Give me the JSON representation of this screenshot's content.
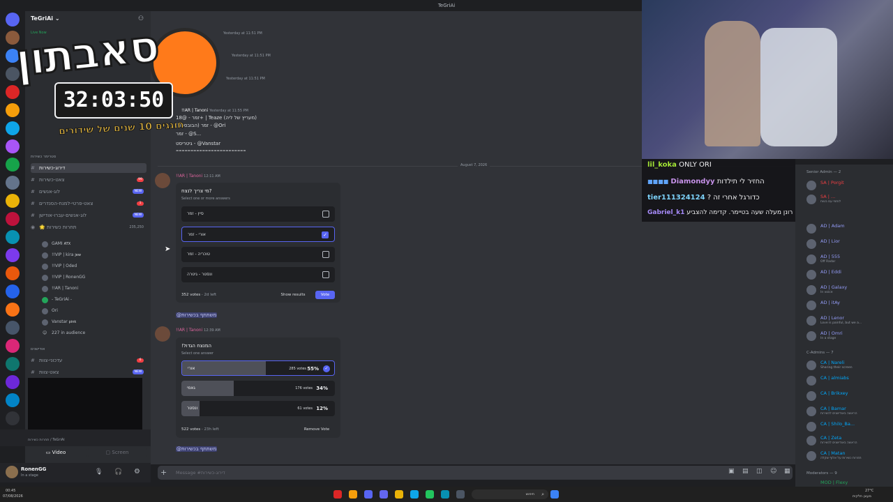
{
  "window": {
    "title": "TeGriAi"
  },
  "server": {
    "name": "TeGriAi",
    "live_label": "Live Now"
  },
  "overlay": {
    "title": "סאבתון",
    "timer": "32:03:50",
    "subtitle": "חוגגים 10 שנים של שידורים"
  },
  "sidebar": {
    "category_1": "סטרימר כשירות",
    "channels": [
      {
        "name": "דירוג-כשירות",
        "active": true
      },
      {
        "name": "צאט-כשירות",
        "badge": "99"
      },
      {
        "name": "לוג-אנשים",
        "badge": "NEW"
      },
      {
        "name": "צאט-פרטי-למנח-הסנדרים",
        "badge": "1"
      },
      {
        "name": "לוג-אנשים-עברו-אודישן",
        "badge": "NEW"
      },
      {
        "name": "🌟 תחרות כשירות",
        "badge": "235,250"
      }
    ],
    "voice_members": [
      {
        "name": "GAMI",
        "tag": "ATX"
      },
      {
        "name": "!!VIP | kira",
        "tag": "jew"
      },
      {
        "name": "!!VIP | Oded"
      },
      {
        "name": "!!VIP | RonenGG"
      },
      {
        "name": "!!AR | Tanoni"
      },
      {
        "name": "- TeGriAi -"
      },
      {
        "name": "Ori"
      },
      {
        "name": "Vanstar",
        "tag": "pink"
      }
    ],
    "audience": "227 in audience",
    "category_2": "אודישנים",
    "channels_2": [
      {
        "name": "עדכוני-צוות",
        "badge": "6"
      },
      {
        "name": "צאט-צוות",
        "badge": "NEW"
      }
    ],
    "voice_status": "תחרות כשירות / TeGriAi",
    "video_label": "Video",
    "screen_label": "Screen",
    "user": {
      "name": "RonenGG",
      "status": "In a stage"
    }
  },
  "chat": {
    "top_messages": [
      {
        "time": "Yesterday at 11:51 PM"
      },
      {
        "time": "Yesterday at 11:51 PM"
      },
      {
        "time": "Yesterday at 11:51 PM"
      }
    ],
    "prev_msg": {
      "author": "!!AR | Tanoni",
      "time": "Yesterday at 11:55 PM",
      "lines": [
        "זמר - @18+ | Teaze (מעריץ של ליה)",
        "זמר (הבובספוג) - @Ori",
        "זמר - @S...",
        "גיטריסט - @Vanstar"
      ],
      "divider": "========================"
    },
    "date_divider": "August 7, 2026",
    "poll1": {
      "author": "!!AR | Tanoni",
      "time": "12:11 AM",
      "question": "מי צריך לנצח?",
      "hint": "Select one or more answers",
      "options": [
        "סיין - זמר",
        "אורי - זמר",
        "טוכריה - זמר",
        "ונסטר - גיטרה"
      ],
      "votes": "352 votes",
      "time_left": "2d left",
      "show_results": "Show results",
      "vote": "Vote",
      "footer": "@משתתף בכשירות"
    },
    "poll2": {
      "author": "!!AR | Tanoni",
      "time": "12:39 AM",
      "question": "!המנצח הגדול",
      "hint": "Select one answer",
      "results": [
        {
          "label": "אורי",
          "votes": "285 votes",
          "pct": "55%",
          "value": 55
        },
        {
          "label": "גאמי",
          "votes": "176 votes",
          "pct": "34%",
          "value": 34
        },
        {
          "label": "ונסטר",
          "votes": "61 votes",
          "pct": "12%",
          "value": 12
        }
      ],
      "votes": "522 votes",
      "time_left": "23h left",
      "remove_vote": "Remove Vote",
      "footer": "@משתתף בכשירות"
    },
    "composer_placeholder": "Message #דירוג-כשירות"
  },
  "twitch_chat": [
    {
      "user": "lil_koka",
      "user_color": "#a3e635",
      "text": "ONLY ORI"
    },
    {
      "user": "Diamondyy",
      "user_color": "#c792ea",
      "text": "החזיר לי תילדות"
    },
    {
      "user": "tier111324124",
      "user_color": "#7dd3fc",
      "text": "? כדורגל אחרי זה"
    },
    {
      "user": "Gabriel_k1",
      "user_color": "#a78bfa",
      "text": "צאט אם אורי זוכה, רונן מעלה שעה בטיימר. קדימה להצביע"
    }
  ],
  "members": {
    "senior_header": "Senior Admin — 2",
    "senior": [
      {
        "name": "SA | Porgit",
        "status": ""
      },
      {
        "name": "SA | ...",
        "status": "לוחמי עם בטוח"
      }
    ],
    "admins": [
      {
        "name": "AD | Adam",
        "status": ""
      },
      {
        "name": "AD | Lior",
        "status": ""
      },
      {
        "name": "AD | 555",
        "status": "Off Radar"
      },
      {
        "name": "AD | Eddi",
        "status": ""
      },
      {
        "name": "AD | Galaxy",
        "status": "In voice"
      },
      {
        "name": "AD | itAy",
        "status": ""
      },
      {
        "name": "AD | Lenor",
        "status": "Love is painful, but we a..."
      },
      {
        "name": "AD | Omri",
        "status": "In a stage"
      }
    ],
    "ca_header": "C-Admins — 7",
    "cas": [
      {
        "name": "CA | Nareli",
        "status": "Sharing their screen"
      },
      {
        "name": "CA | almiabs",
        "status": ""
      },
      {
        "name": "CA | Brikxey",
        "status": ""
      },
      {
        "name": "CA | Bamar",
        "status": "הראשה באודישנים לכשירות"
      },
      {
        "name": "CA | Shilo_Ba...",
        "status": ""
      },
      {
        "name": "CA | Zeta",
        "status": "הראשה באודישנים לכשירות"
      },
      {
        "name": "CA | Matan",
        "status": "תחרות כשירות על אלוף שקלה"
      }
    ],
    "mods_header": "Moderators — 9",
    "mod_first": "MOD | Flexy"
  },
  "taskbar": {
    "time": "00:45",
    "date": "07/08/2026",
    "weather": "27°C",
    "weather_sub": "מעונן חלקית",
    "search": "חיפוש"
  }
}
